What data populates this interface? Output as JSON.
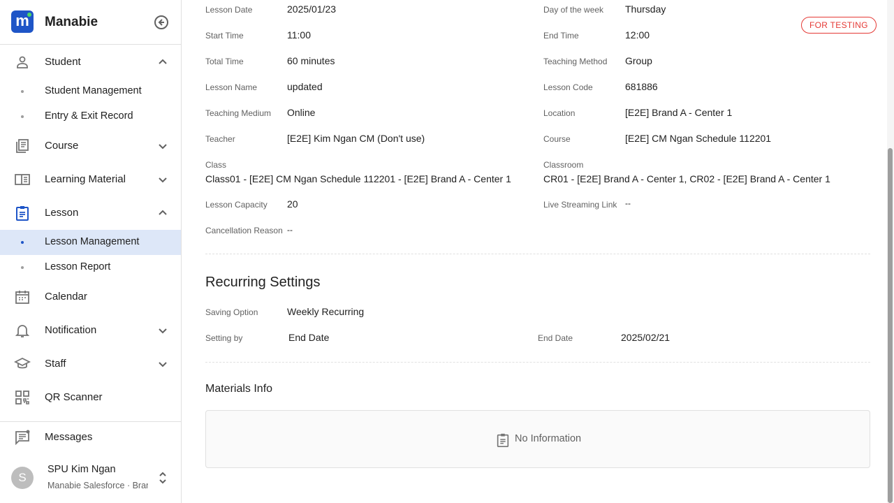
{
  "brand": {
    "name": "Manabie",
    "logo_letter": "m"
  },
  "colors": {
    "primary": "#1e55c7",
    "active_bg": "#dde7f8",
    "danger": "#e53935"
  },
  "sidebar": {
    "items": [
      {
        "label": "Student",
        "icon": "person-icon",
        "expanded": true
      },
      {
        "label": "Student Management"
      },
      {
        "label": "Entry & Exit Record"
      },
      {
        "label": "Course",
        "icon": "course-icon",
        "expanded": false
      },
      {
        "label": "Learning Material",
        "icon": "book-icon",
        "expanded": false
      },
      {
        "label": "Lesson",
        "icon": "clipboard-icon",
        "expanded": true
      },
      {
        "label": "Lesson Management",
        "active": true
      },
      {
        "label": "Lesson Report"
      },
      {
        "label": "Calendar",
        "icon": "calendar-icon"
      },
      {
        "label": "Notification",
        "icon": "bell-icon",
        "expanded": false
      },
      {
        "label": "Staff",
        "icon": "school-icon",
        "expanded": false
      },
      {
        "label": "QR Scanner",
        "icon": "qr-icon"
      }
    ],
    "messages_label": "Messages",
    "user": {
      "initial": "S",
      "name": "SPU Kim Ngan",
      "org": "Manabie Salesforce · Brand A"
    }
  },
  "lesson": {
    "badge": "FOR TESTING",
    "fields": {
      "lesson_date_label": "Lesson Date",
      "lesson_date": "2025/01/23",
      "day_label": "Day of the week",
      "day": "Thursday",
      "start_time_label": "Start Time",
      "start_time": "11:00",
      "end_time_label": "End Time",
      "end_time": "12:00",
      "total_time_label": "Total Time",
      "total_time": "60 minutes",
      "teaching_method_label": "Teaching Method",
      "teaching_method": "Group",
      "lesson_name_label": "Lesson Name",
      "lesson_name": "updated",
      "lesson_code_label": "Lesson Code",
      "lesson_code": "681886",
      "teaching_medium_label": "Teaching Medium",
      "teaching_medium": "Online",
      "location_label": "Location",
      "location": "[E2E] Brand A - Center 1",
      "teacher_label": "Teacher",
      "teacher": "[E2E] Kim Ngan CM (Don't use)",
      "course_label": "Course",
      "course": "[E2E] CM Ngan Schedule 112201",
      "class_label": "Class",
      "class": "Class01 - [E2E] CM Ngan Schedule 112201 - [E2E] Brand A - Center 1",
      "classroom_label": "Classroom",
      "classroom": "CR01 - [E2E] Brand A - Center 1, CR02 - [E2E] Brand A - Center 1",
      "capacity_label": "Lesson Capacity",
      "capacity": "20",
      "streaming_label": "Live Streaming Link",
      "streaming": "--",
      "cancel_label": "Cancellation Reason",
      "cancel": "--"
    }
  },
  "recurring": {
    "title": "Recurring Settings",
    "saving_option_label": "Saving Option",
    "saving_option": "Weekly Recurring",
    "setting_by_label": "Setting by",
    "setting_by": "End Date",
    "end_date_label": "End Date",
    "end_date": "2025/02/21"
  },
  "materials": {
    "title": "Materials Info",
    "empty_text": "No Information"
  }
}
